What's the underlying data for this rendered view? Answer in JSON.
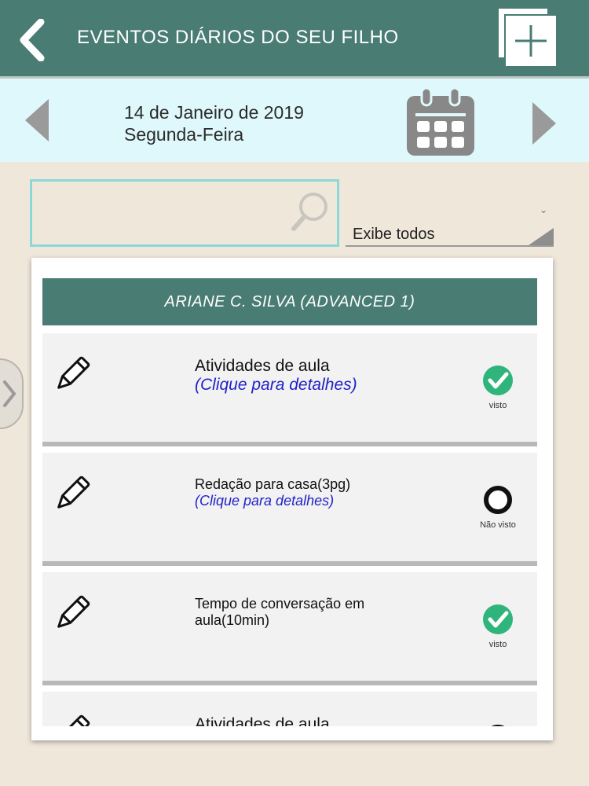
{
  "header": {
    "title": "EVENTOS DIÁRIOS DO SEU FILHO"
  },
  "datebar": {
    "date": "14 de Janeiro de 2019",
    "weekday": "Segunda-Feira"
  },
  "search": {
    "value": "",
    "placeholder": ""
  },
  "filter": {
    "selected": "Exibe todos"
  },
  "student": {
    "name": "ARIANE C. SILVA (ADVANCED 1)"
  },
  "events": [
    {
      "title": "Atividades de aula",
      "detail": "(Clique para detalhes)",
      "status": "visto"
    },
    {
      "title": "Redação para casa(3pg)",
      "detail": "(Clique para detalhes)",
      "status": "Não visto"
    },
    {
      "title": "Tempo de conversação em aula(10min)",
      "detail": "",
      "status": "visto"
    },
    {
      "title": "Atividades de aula",
      "detail": "",
      "status": ""
    }
  ],
  "colors": {
    "header": "#497c72",
    "datebar": "#dff8fb",
    "background": "#f0e7db",
    "seen": "#2fb57c",
    "detail_link": "#2222c8"
  },
  "icons": [
    "back-arrow-icon",
    "add-icon",
    "chevron-left-icon",
    "calendar-icon",
    "chevron-right-icon",
    "search-icon",
    "pencil-icon",
    "check-circle-icon",
    "open-circle-icon"
  ]
}
